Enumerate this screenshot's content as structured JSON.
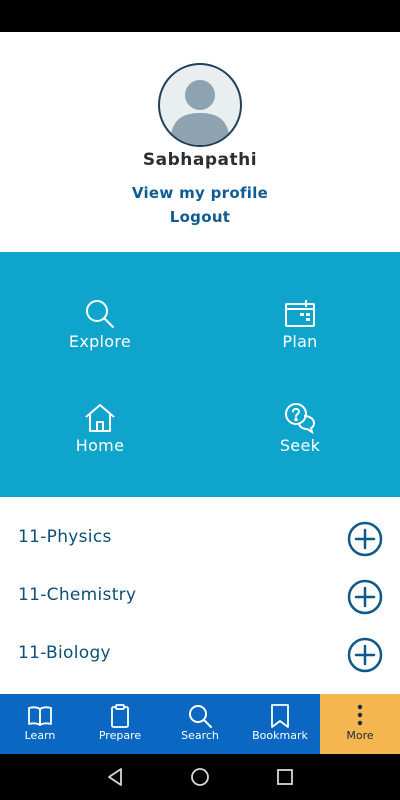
{
  "profile": {
    "username": "Sabhapathi",
    "view_profile_label": "View my profile",
    "logout_label": "Logout",
    "avatar_icon": "user-avatar-icon"
  },
  "quick_actions": [
    {
      "label": "Explore",
      "icon": "search-icon"
    },
    {
      "label": "Plan",
      "icon": "calendar-icon"
    },
    {
      "label": "Home",
      "icon": "home-icon"
    },
    {
      "label": "Seek",
      "icon": "question-chat-icon"
    }
  ],
  "subjects": [
    {
      "label": "11-Physics",
      "icon": "plus-circle-icon"
    },
    {
      "label": "11-Chemistry",
      "icon": "plus-circle-icon"
    },
    {
      "label": "11-Biology",
      "icon": "plus-circle-icon"
    }
  ],
  "bottom_nav": {
    "active": "More",
    "items": [
      {
        "label": "Learn",
        "icon": "book-icon"
      },
      {
        "label": "Prepare",
        "icon": "clipboard-icon"
      },
      {
        "label": "Search",
        "icon": "search-icon"
      },
      {
        "label": "Bookmark",
        "icon": "bookmark-icon"
      },
      {
        "label": "More",
        "icon": "more-vertical-icon"
      }
    ]
  },
  "system_nav": [
    "back-icon",
    "home-circle-icon",
    "recent-apps-icon"
  ],
  "colors": {
    "quick_grid_bg": "#0ea4cc",
    "bottom_nav_bg": "#0a67c2",
    "active_tab_bg": "#f5b650",
    "link_text": "#0e5c93",
    "subject_text": "#0d4f78"
  }
}
